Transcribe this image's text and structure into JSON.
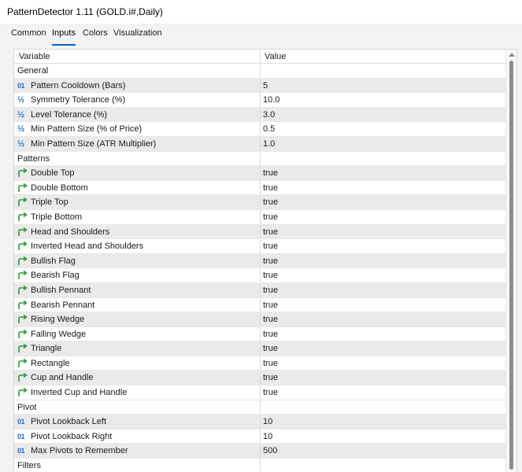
{
  "window": {
    "title": "PatternDetector 1.11 (GOLD.i#,Daily)"
  },
  "tabs": [
    {
      "label": "Common"
    },
    {
      "label": "Inputs"
    },
    {
      "label": "Colors"
    },
    {
      "label": "Visualization"
    }
  ],
  "active_tab": "Inputs",
  "grid": {
    "headers": {
      "variable": "Variable",
      "value": "Value"
    },
    "rows": [
      {
        "kind": "group",
        "label": "General",
        "value": ""
      },
      {
        "kind": "int",
        "label": "Pattern Cooldown (Bars)",
        "value": "5"
      },
      {
        "kind": "double",
        "label": "Symmetry Tolerance (%)",
        "value": "10.0"
      },
      {
        "kind": "double",
        "label": "Level Tolerance (%)",
        "value": "3.0"
      },
      {
        "kind": "double",
        "label": "Min Pattern Size (% of Price)",
        "value": "0.5"
      },
      {
        "kind": "double",
        "label": "Min Pattern Size (ATR Multiplier)",
        "value": "1.0"
      },
      {
        "kind": "group",
        "label": "Patterns",
        "value": ""
      },
      {
        "kind": "bool",
        "label": "Double Top",
        "value": "true"
      },
      {
        "kind": "bool",
        "label": "Double Bottom",
        "value": "true"
      },
      {
        "kind": "bool",
        "label": "Triple Top",
        "value": "true"
      },
      {
        "kind": "bool",
        "label": "Triple Bottom",
        "value": "true"
      },
      {
        "kind": "bool",
        "label": "Head and Shoulders",
        "value": "true"
      },
      {
        "kind": "bool",
        "label": "Inverted Head and Shoulders",
        "value": "true"
      },
      {
        "kind": "bool",
        "label": "Bullish Flag",
        "value": "true"
      },
      {
        "kind": "bool",
        "label": "Bearish Flag",
        "value": "true"
      },
      {
        "kind": "bool",
        "label": "Bullish Pennant",
        "value": "true"
      },
      {
        "kind": "bool",
        "label": "Bearish Pennant",
        "value": "true"
      },
      {
        "kind": "bool",
        "label": "Rising Wedge",
        "value": "true"
      },
      {
        "kind": "bool",
        "label": "Falling Wedge",
        "value": "true"
      },
      {
        "kind": "bool",
        "label": "Triangle",
        "value": "true"
      },
      {
        "kind": "bool",
        "label": "Rectangle",
        "value": "true"
      },
      {
        "kind": "bool",
        "label": "Cup and Handle",
        "value": "true"
      },
      {
        "kind": "bool",
        "label": "Inverted Cup and Handle",
        "value": "true"
      },
      {
        "kind": "group",
        "label": "Pivot",
        "value": ""
      },
      {
        "kind": "int",
        "label": "Pivot Lookback Left",
        "value": "10"
      },
      {
        "kind": "int",
        "label": "Pivot Lookback Right",
        "value": "10"
      },
      {
        "kind": "int",
        "label": "Max Pivots to Remember",
        "value": "500"
      },
      {
        "kind": "group",
        "label": "Filters",
        "value": ""
      }
    ]
  },
  "icons": {
    "int": "int-type-icon",
    "double": "double-type-icon",
    "bool": "bool-type-icon",
    "int_glyph": "01",
    "double_glyph": "½"
  },
  "colors": {
    "accent": "#0067c0",
    "icon_blue": "#1e6fd0",
    "icon_green": "#2e9a3a"
  }
}
